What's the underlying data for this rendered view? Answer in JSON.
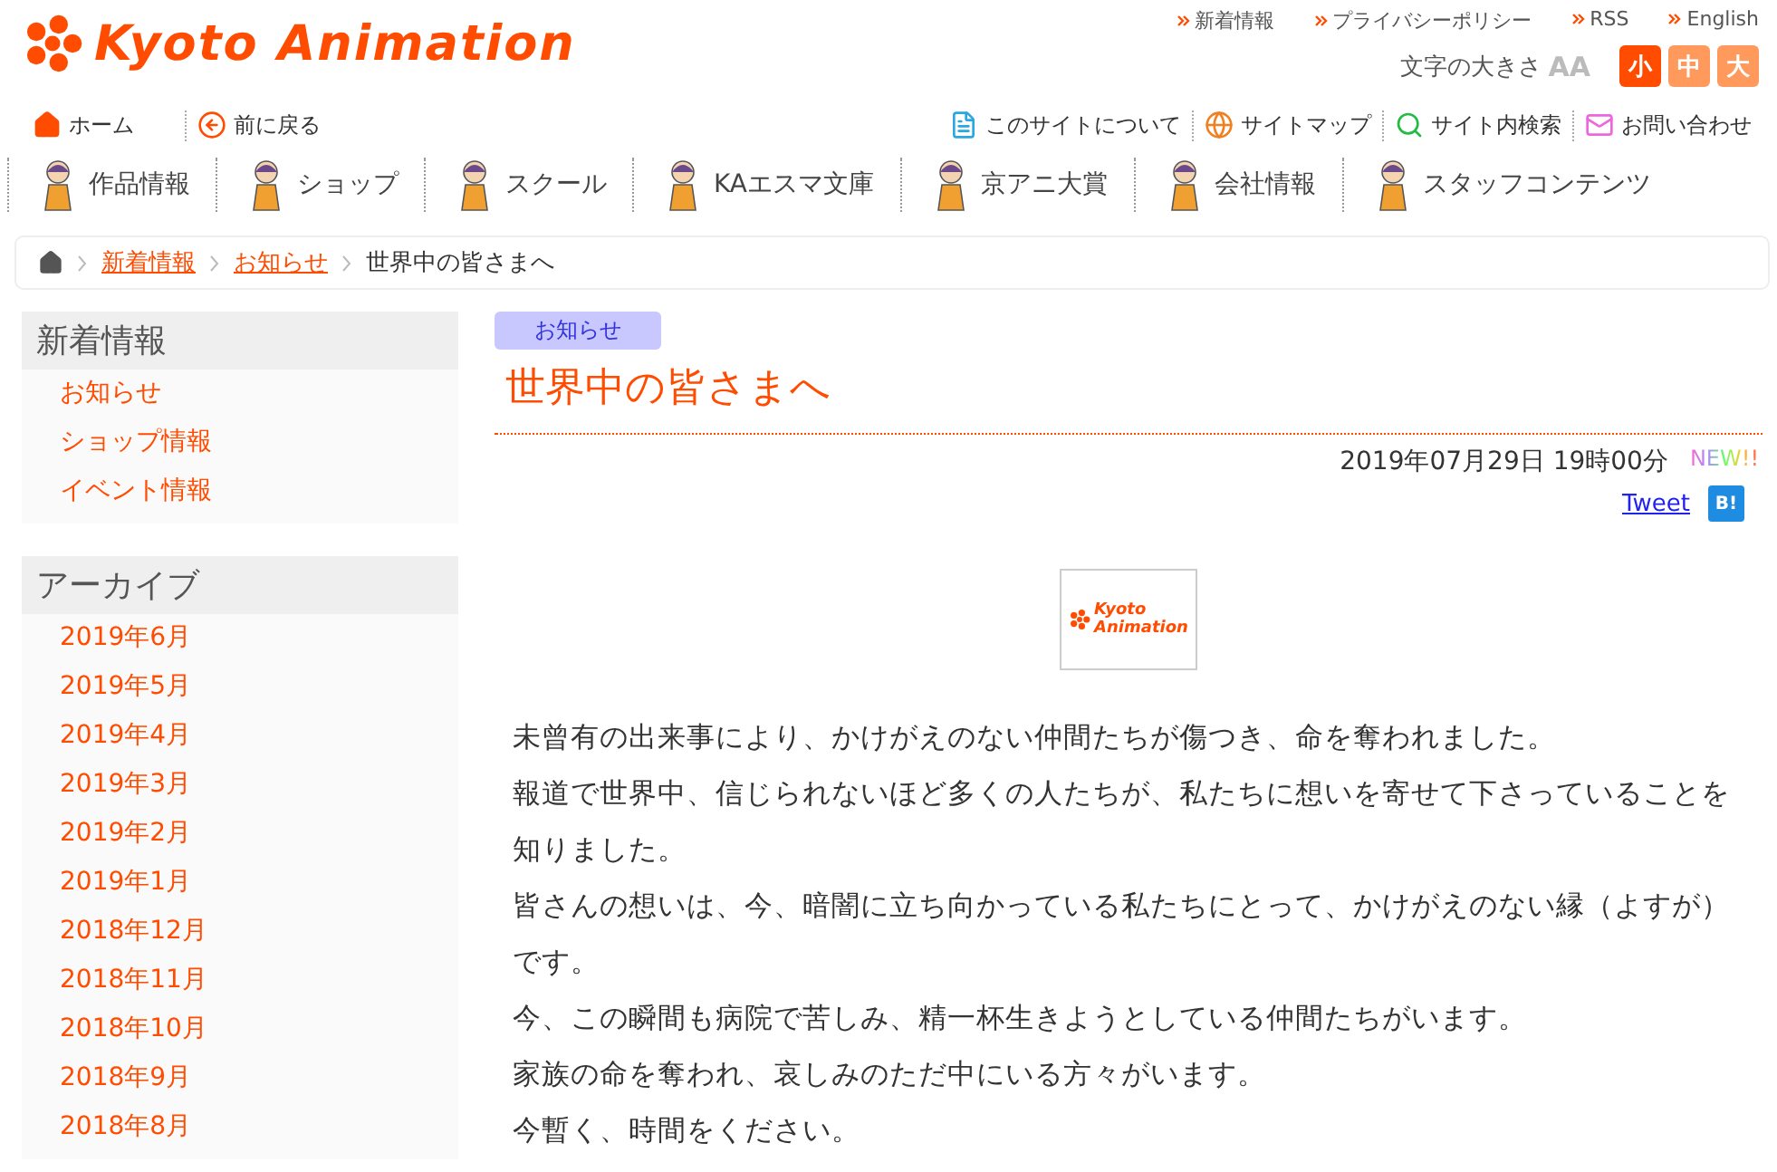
{
  "header": {
    "logo": "Kyoto Animation",
    "top_links": [
      "新着情報",
      "プライバシーポリシー",
      "RSS",
      "English"
    ],
    "text_size": {
      "label": "文字の大きさ",
      "glyph": "AA",
      "options": [
        {
          "label": "小",
          "selected": true
        },
        {
          "label": "中",
          "selected": false
        },
        {
          "label": "大",
          "selected": false
        }
      ]
    }
  },
  "utility_nav": {
    "left": [
      {
        "label": "ホーム",
        "kind": "home"
      },
      {
        "label": "前に戻る",
        "kind": "back"
      }
    ],
    "right": [
      {
        "label": "このサイトについて",
        "kind": "doc"
      },
      {
        "label": "サイトマップ",
        "kind": "globe"
      },
      {
        "label": "サイト内検索",
        "kind": "search"
      },
      {
        "label": "お問い合わせ",
        "kind": "mail"
      }
    ]
  },
  "main_nav": [
    "作品情報",
    "ショップ",
    "スクール",
    "KAエスマ文庫",
    "京アニ大賞",
    "会社情報",
    "スタッフコンテンツ"
  ],
  "breadcrumb": {
    "links": [
      "新着情報",
      "お知らせ"
    ],
    "current": "世界中の皆さまへ"
  },
  "sidebar": [
    {
      "title": "新着情報",
      "items": [
        "お知らせ",
        "ショップ情報",
        "イベント情報"
      ]
    },
    {
      "title": "アーカイブ",
      "items": [
        "2019年6月",
        "2019年5月",
        "2019年4月",
        "2019年3月",
        "2019年2月",
        "2019年1月",
        "2018年12月",
        "2018年11月",
        "2018年10月",
        "2018年9月",
        "2018年8月"
      ]
    }
  ],
  "article": {
    "category": "お知らせ",
    "title": "世界中の皆さまへ",
    "date": "2019年07月29日 19時00分",
    "new_badge": "NEW!!",
    "tweet": "Tweet",
    "bookmark": "B!",
    "logo_text": [
      "Kyoto",
      "Animation"
    ],
    "paragraphs": [
      "未曾有の出来事により、かけがえのない仲間たちが傷つき、命を奪われました。",
      "報道で世界中、信じられないほど多くの人たちが、私たちに想いを寄せて下さっていることを知りました。",
      "皆さんの想いは、今、暗闇に立ち向かっている私たちにとって、かけがえのない縁（よすが）です。",
      "今、この瞬間も病院で苦しみ、精一杯生きようとしている仲間たちがいます。",
      "家族の命を奪われ、哀しみのただ中にいる方々がいます。",
      "今暫く、時間をください。"
    ]
  }
}
